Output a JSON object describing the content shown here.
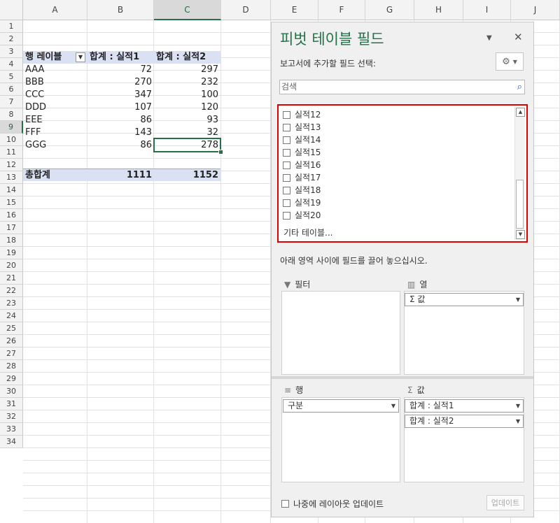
{
  "columns": [
    "A",
    "B",
    "C",
    "D",
    "E",
    "F",
    "G",
    "H",
    "I",
    "J"
  ],
  "rows": [
    "1",
    "2",
    "3",
    "4",
    "5",
    "6",
    "7",
    "8",
    "9",
    "10",
    "11",
    "12",
    "13",
    "14",
    "15",
    "16",
    "17",
    "18",
    "19",
    "20",
    "21",
    "22",
    "23",
    "24",
    "25",
    "26",
    "27",
    "28",
    "29",
    "30",
    "31",
    "32",
    "33",
    "34"
  ],
  "pivot": {
    "header": {
      "row_label": "행 레이블",
      "col1": "합계 : 실적1",
      "col2": "합계 : 실적2"
    },
    "data": [
      {
        "label": "AAA",
        "v1": "72",
        "v2": "297"
      },
      {
        "label": "BBB",
        "v1": "270",
        "v2": "232"
      },
      {
        "label": "CCC",
        "v1": "347",
        "v2": "100"
      },
      {
        "label": "DDD",
        "v1": "107",
        "v2": "120"
      },
      {
        "label": "EEE",
        "v1": "86",
        "v2": "93"
      },
      {
        "label": "FFF",
        "v1": "143",
        "v2": "32"
      },
      {
        "label": "GGG",
        "v1": "86",
        "v2": "278"
      }
    ],
    "total": {
      "label": "총합계",
      "v1": "1111",
      "v2": "1152"
    }
  },
  "pane": {
    "title": "피벗 테이블 필드",
    "subtitle": "보고서에 추가할 필드 선택:",
    "search_placeholder": "검색",
    "fields": [
      "실적12",
      "실적13",
      "실적14",
      "실적15",
      "실적16",
      "실적17",
      "실적18",
      "실적19",
      "실적20"
    ],
    "more_tables": "기타 테이블...",
    "hint": "아래 영역 사이에 필드를 끌어 놓으십시오.",
    "areas": {
      "filter": {
        "label": "필터",
        "items": []
      },
      "columns": {
        "label": "열",
        "items": [
          "Σ 값"
        ]
      },
      "rows": {
        "label": "행",
        "items": [
          "구분"
        ]
      },
      "values": {
        "label": "값",
        "items": [
          "합계 : 실적1",
          "합계 : 실적2"
        ]
      }
    },
    "defer_label": "나중에 레이아웃 업데이트",
    "update_label": "업데이트"
  },
  "icons": {
    "settings": "gear-icon",
    "search": "search-icon",
    "close": "close-icon",
    "dropdown": "chevron-down-icon"
  },
  "colors": {
    "accent": "#217346",
    "pivot_header": "#d9e1f2",
    "highlight_border": "#e00000"
  }
}
